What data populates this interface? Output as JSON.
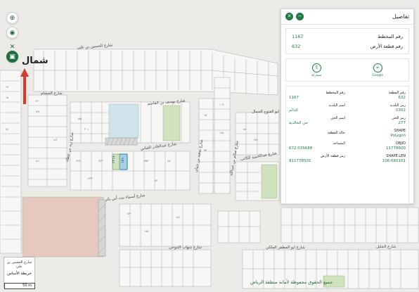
{
  "map": {
    "streets": {
      "top": "شارع الحسين بن علي",
      "jaafar": "شارع الجشام",
      "yousef": "شارع يوسف بن القاسم",
      "abdulqader": "شارع عبدالقادر القباني",
      "zaid": "شارع زيد بن عطاء",
      "saeed": "شارع سعيد بن جمان",
      "fouthoh": "شارع ابو الفتوح الجمال",
      "salem": "شارع سالم بن عبدالله",
      "abdulhameed": "شارع عبدالحميد الكاتب",
      "asmaa": "شارع أسماء بنت أبي بكر",
      "shehab": "شارع شهاب التنوخي",
      "mudhaffar": "شارع ابو المظفر الملكي",
      "alkhalil": "شارع الخليل"
    },
    "highlighted_parcels": [
      "٢٣١٨",
      "١٥٩"
    ],
    "parcel_samples": [
      "١٣",
      "١٥",
      "٧٤",
      "١٣٠",
      "١٣٧",
      "١٤٣",
      "١٤١",
      "١٥٥",
      "٢٠١",
      "٢٢٧",
      "٢٣٣",
      "٣٤٣",
      "٣٥٣",
      "٤٣",
      "٤٥",
      "٦٨",
      "٩٣",
      "١٠٣",
      "١٤٥",
      "١٥١",
      "١٧٧",
      "١٧٣",
      "١٩٥",
      "١٨١"
    ]
  },
  "toolbar": {
    "north_label": "شمال"
  },
  "inset": {
    "top_text": "شارع الحسين بن علي",
    "label": "خريطة الأساس"
  },
  "scale": {
    "label": "50 m"
  },
  "copyright": "جميع الحقوق محفوظة لأمانة منطقة الرياض",
  "panel": {
    "title": "تفاصيل",
    "summary": [
      {
        "label": "رقم المخطط",
        "value": "1167"
      },
      {
        "label": "رقم قطعة الأرض",
        "value": "632"
      }
    ],
    "actions": [
      {
        "label": "Google",
        "icon": "map-pin-icon"
      },
      {
        "label": "مشاركة",
        "icon": "share-icon"
      }
    ],
    "attributes": [
      {
        "label": "رقم القطعة",
        "value": "632"
      },
      {
        "label": "رقم المخطط",
        "value": "1167"
      },
      {
        "label": "رمز البلدية",
        "value": "0302"
      },
      {
        "label": "اسم البلدية",
        "value": "الدائم"
      },
      {
        "label": "رمز الحي",
        "value": "277"
      },
      {
        "label": "اسم الحي",
        "value": "حي الخالدية"
      },
      {
        "label": "SHAPE",
        "value": "Polygon"
      },
      {
        "label": "حالة القطعة",
        "value": ""
      },
      {
        "label": "OBJID",
        "value": "11778600"
      },
      {
        "label": "المساحة",
        "value": "672.035688"
      },
      {
        "label": "SHAPE.LEN",
        "value": "106.660101"
      },
      {
        "label": "رمز قطعة الأرض",
        "value": "911778501"
      }
    ]
  },
  "colors": {
    "accent": "#1d7a45",
    "park_green": "#cfe2bd",
    "park_blue": "#cfe4ea",
    "building": "#e5c9bf",
    "arrow": "#d63a2a"
  }
}
